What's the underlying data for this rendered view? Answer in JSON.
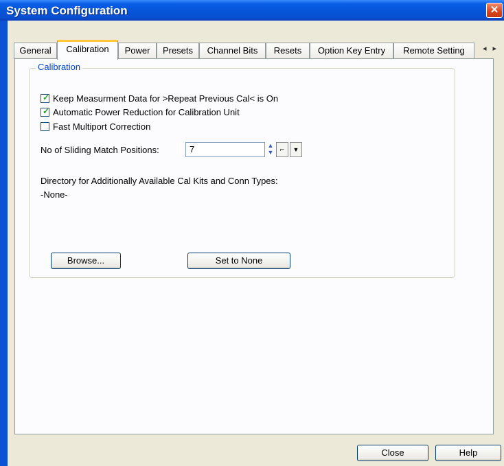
{
  "window": {
    "title": "System Configuration",
    "close_glyph": "✕"
  },
  "tabs": [
    {
      "label": "General"
    },
    {
      "label": "Calibration"
    },
    {
      "label": "Power"
    },
    {
      "label": "Presets"
    },
    {
      "label": "Channel Bits"
    },
    {
      "label": "Resets"
    },
    {
      "label": "Option Key Entry"
    },
    {
      "label": "Remote Setting"
    }
  ],
  "tab_scroll": {
    "left": "◂",
    "right": "▸"
  },
  "calibration": {
    "group_label": "Calibration",
    "checkboxes": [
      {
        "label": "Keep Measurment Data for >Repeat Previous Cal< is On",
        "checked": true
      },
      {
        "label": "Automatic Power Reduction for Calibration Unit",
        "checked": true
      },
      {
        "label": "Fast Multiport Correction",
        "checked": false
      }
    ],
    "sliding_label": "No of Sliding Match Positions:",
    "sliding_value": "7",
    "directory_label": "Directory for Additionally Available Cal Kits and Conn Types:",
    "directory_value": "-None-",
    "browse_label": "Browse...",
    "set_none_label": "Set to None"
  },
  "footer": {
    "close_label": "Close",
    "help_label": "Help"
  },
  "icons": {
    "spin": "spin-arrows-icon",
    "step": "step-icon",
    "dropdown": "dropdown-arrow-icon"
  }
}
